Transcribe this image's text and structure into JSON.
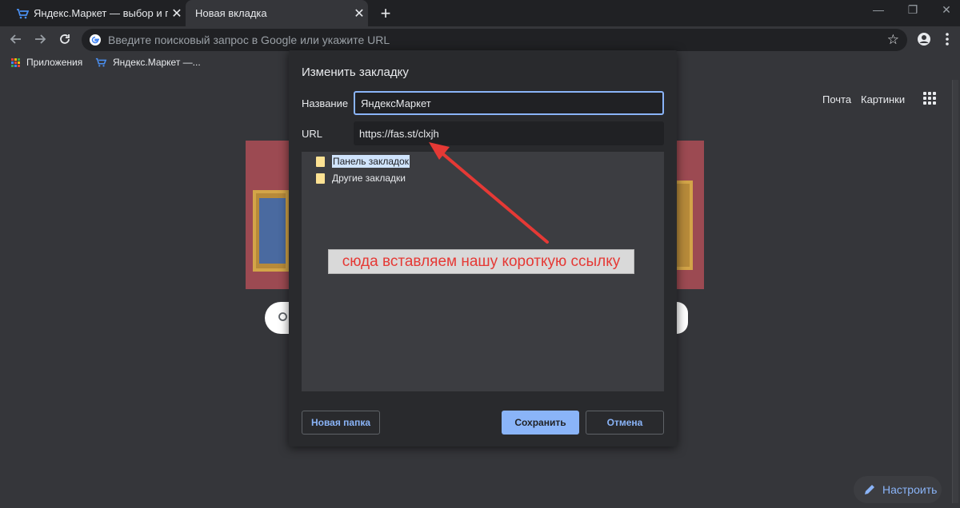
{
  "tabs": [
    {
      "title": "Яндекс.Маркет — выбор и поку",
      "close": "✕"
    },
    {
      "title": "Новая вкладка",
      "close": "✕"
    }
  ],
  "new_tab": "+",
  "window_controls": {
    "minimize": "—",
    "maximize": "❐",
    "close": "✕"
  },
  "omnibox": {
    "placeholder": "Введите поисковый запрос в Google или укажите URL"
  },
  "bookmarks": {
    "apps_label": "Приложения",
    "items": [
      {
        "label": "Яндекс.Маркет —..."
      }
    ]
  },
  "ntp": {
    "links": [
      {
        "label": "Почта"
      },
      {
        "label": "Картинки"
      }
    ],
    "customize_label": "Настроить"
  },
  "dialog": {
    "title": "Изменить закладку",
    "name_label": "Название",
    "name_value": "ЯндексМаркет",
    "url_label": "URL",
    "url_value": "https://fas.st/clxjh",
    "folders": [
      {
        "label": "Панель закладок",
        "selected": true
      },
      {
        "label": "Другие закладки",
        "selected": false
      }
    ],
    "new_folder_label": "Новая папка",
    "save_label": "Сохранить",
    "cancel_label": "Отмена"
  },
  "annotation": {
    "text": "сюда вставляем нашу короткую ссылку"
  },
  "colors": {
    "accent": "#8ab4f8",
    "annotation_red": "#e53935",
    "folder": "#fde293",
    "background": "#35363a"
  },
  "icons": [
    "back-icon",
    "forward-icon",
    "reload-icon",
    "google-icon",
    "star-icon",
    "profile-icon",
    "menu-icon",
    "apps-icon",
    "folder-icon",
    "pencil-icon",
    "cart-icon"
  ]
}
